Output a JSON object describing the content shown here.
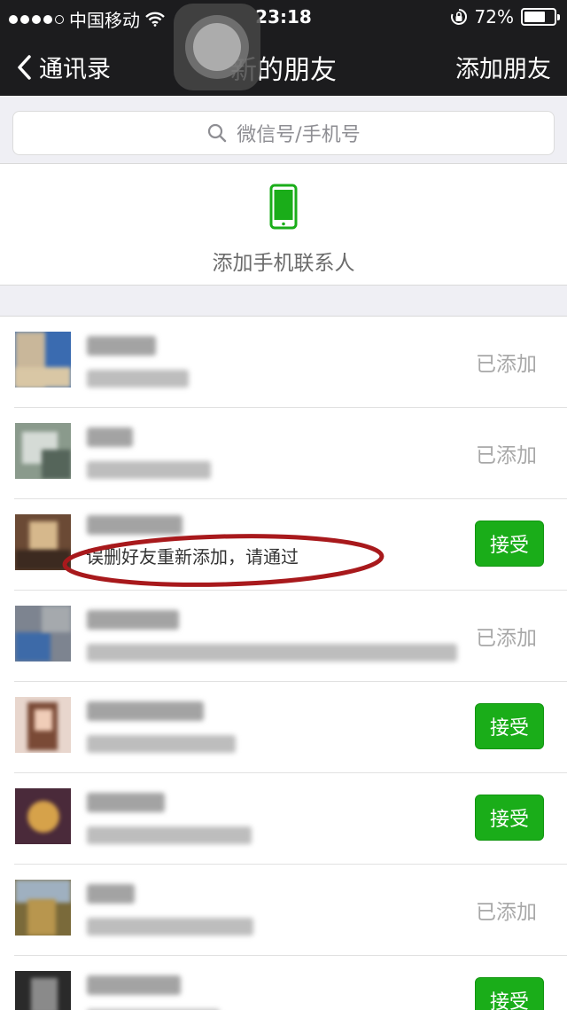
{
  "status_bar": {
    "carrier": "中国移动",
    "time": "23:18",
    "battery_percent": 72,
    "battery_text": "72%"
  },
  "nav": {
    "back_label": "通讯录",
    "title": "新的朋友",
    "action_label": "添加朋友"
  },
  "search": {
    "placeholder": "微信号/手机号"
  },
  "add_phone_contacts": {
    "label": "添加手机联系人"
  },
  "requests": [
    {
      "status": "已添加"
    },
    {
      "status": "已添加"
    },
    {
      "status": "接受",
      "message": "误删好友重新添加，请通过"
    },
    {
      "status": "已添加"
    },
    {
      "status": "接受"
    },
    {
      "status": "接受"
    },
    {
      "status": "已添加"
    },
    {
      "status": "接受"
    }
  ],
  "colors": {
    "accent_green": "#1aad19",
    "annotation_red": "#a8191c",
    "bar_dark": "#1c1c1e"
  }
}
